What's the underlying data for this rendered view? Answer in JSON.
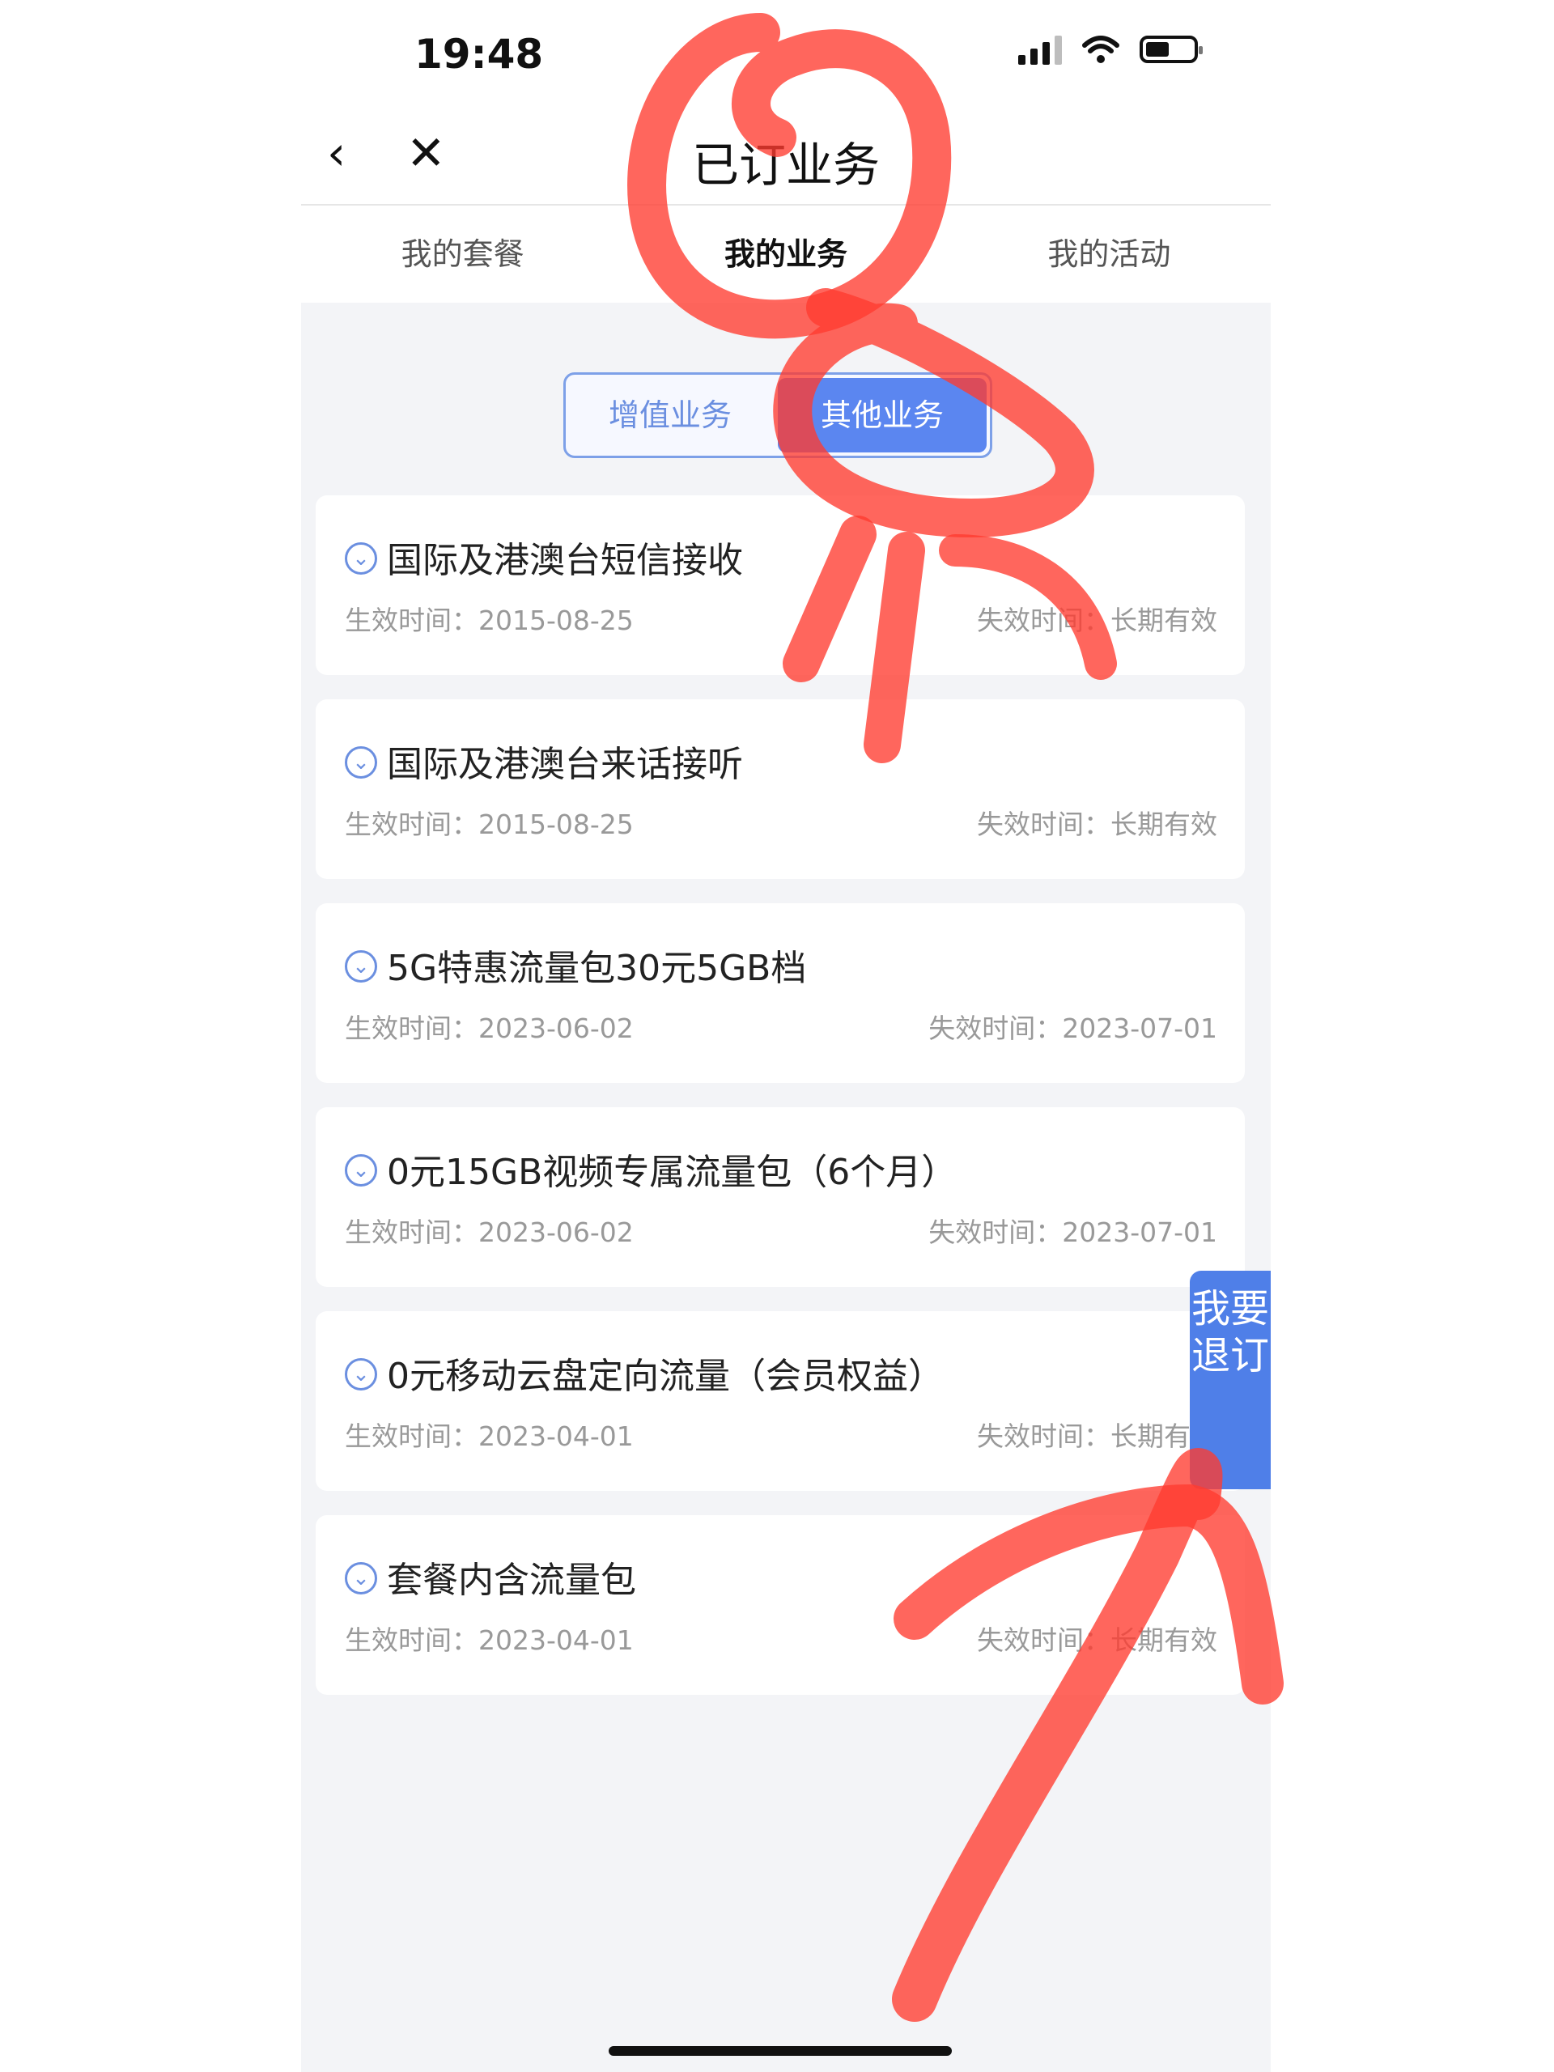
{
  "status": {
    "time": "19:48"
  },
  "nav": {
    "title": "已订业务",
    "back_icon": "‹",
    "close_icon": "✕"
  },
  "tabs": [
    {
      "label": "我的套餐"
    },
    {
      "label": "我的业务"
    },
    {
      "label": "我的活动"
    }
  ],
  "segment": {
    "left": "增值业务",
    "right": "其他业务"
  },
  "items": [
    {
      "name": "国际及港澳台短信接收",
      "start": "生效时间：2015-08-25",
      "end": "失效时间：长期有效"
    },
    {
      "name": "国际及港澳台来话接听",
      "start": "生效时间：2015-08-25",
      "end": "失效时间：长期有效"
    },
    {
      "name": "5G特惠流量包30元5GB档",
      "start": "生效时间：2023-06-02",
      "end": "失效时间：2023-07-01"
    },
    {
      "name": "0元15GB视频专属流量包（6个月）",
      "start": "生效时间：2023-06-02",
      "end": "失效时间：2023-07-01"
    },
    {
      "name": "0元移动云盘定向流量（会员权益）",
      "start": "生效时间：2023-04-01",
      "end": "失效时间：长期有效"
    },
    {
      "name": "套餐内含流量包",
      "start": "生效时间：2023-04-01",
      "end": "失效时间：长期有效"
    }
  ],
  "unsubscribe": {
    "label": "我要退订"
  },
  "colors": {
    "accent": "#5b86f0",
    "annotation": "#ff3b30"
  }
}
